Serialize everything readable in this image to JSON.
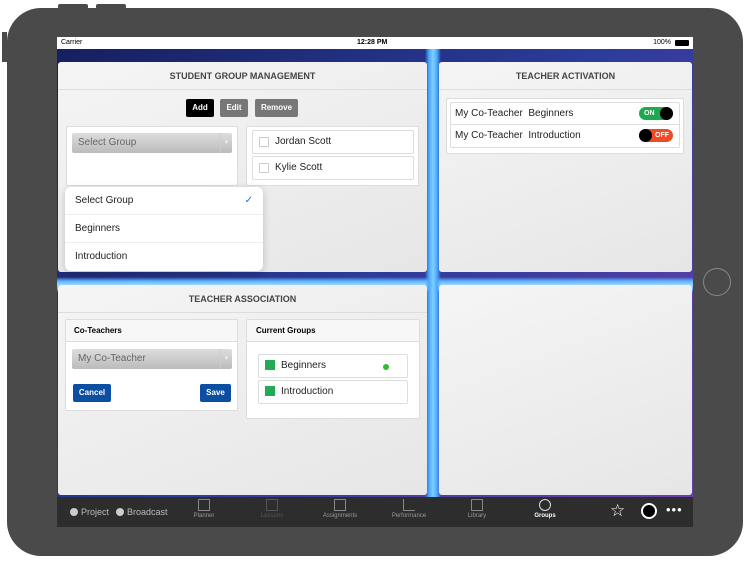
{
  "status": {
    "carrier": "Carrier",
    "time": "12:28 PM",
    "battery": "100%"
  },
  "sgm": {
    "title": "STUDENT GROUP MANAGEMENT",
    "add": "Add",
    "edit": "Edit",
    "remove": "Remove",
    "select_value": "Select Group",
    "students": [
      "Jordan Scott",
      "Kylie Scott"
    ],
    "dropdown": [
      {
        "label": "Select Group",
        "selected": true
      },
      {
        "label": "Beginners"
      },
      {
        "label": "Introduction"
      }
    ]
  },
  "ta": {
    "title": "TEACHER ACTIVATION",
    "rows": [
      {
        "teacher": "My Co-Teacher",
        "group": "Beginners",
        "state": "ON"
      },
      {
        "teacher": "My Co-Teacher",
        "group": "Introduction",
        "state": "OFF"
      }
    ]
  },
  "assoc": {
    "title": "TEACHER ASSOCIATION",
    "coteachers_label": "Co-Teachers",
    "coteacher_value": "My Co-Teacher",
    "cancel": "Cancel",
    "save": "Save",
    "current_groups_label": "Current Groups",
    "groups": [
      "Beginners",
      "Introduction"
    ]
  },
  "tabbar": {
    "project": "Project",
    "broadcast": "Broadcast",
    "tabs": [
      "Planner",
      "Lessons",
      "Assignments",
      "Performance",
      "Library",
      "Groups"
    ],
    "active": "Groups"
  },
  "colors": {
    "on": "#1ea84f",
    "off": "#f04a24",
    "blue": "#0b4ea2",
    "green": "#22aa55"
  }
}
